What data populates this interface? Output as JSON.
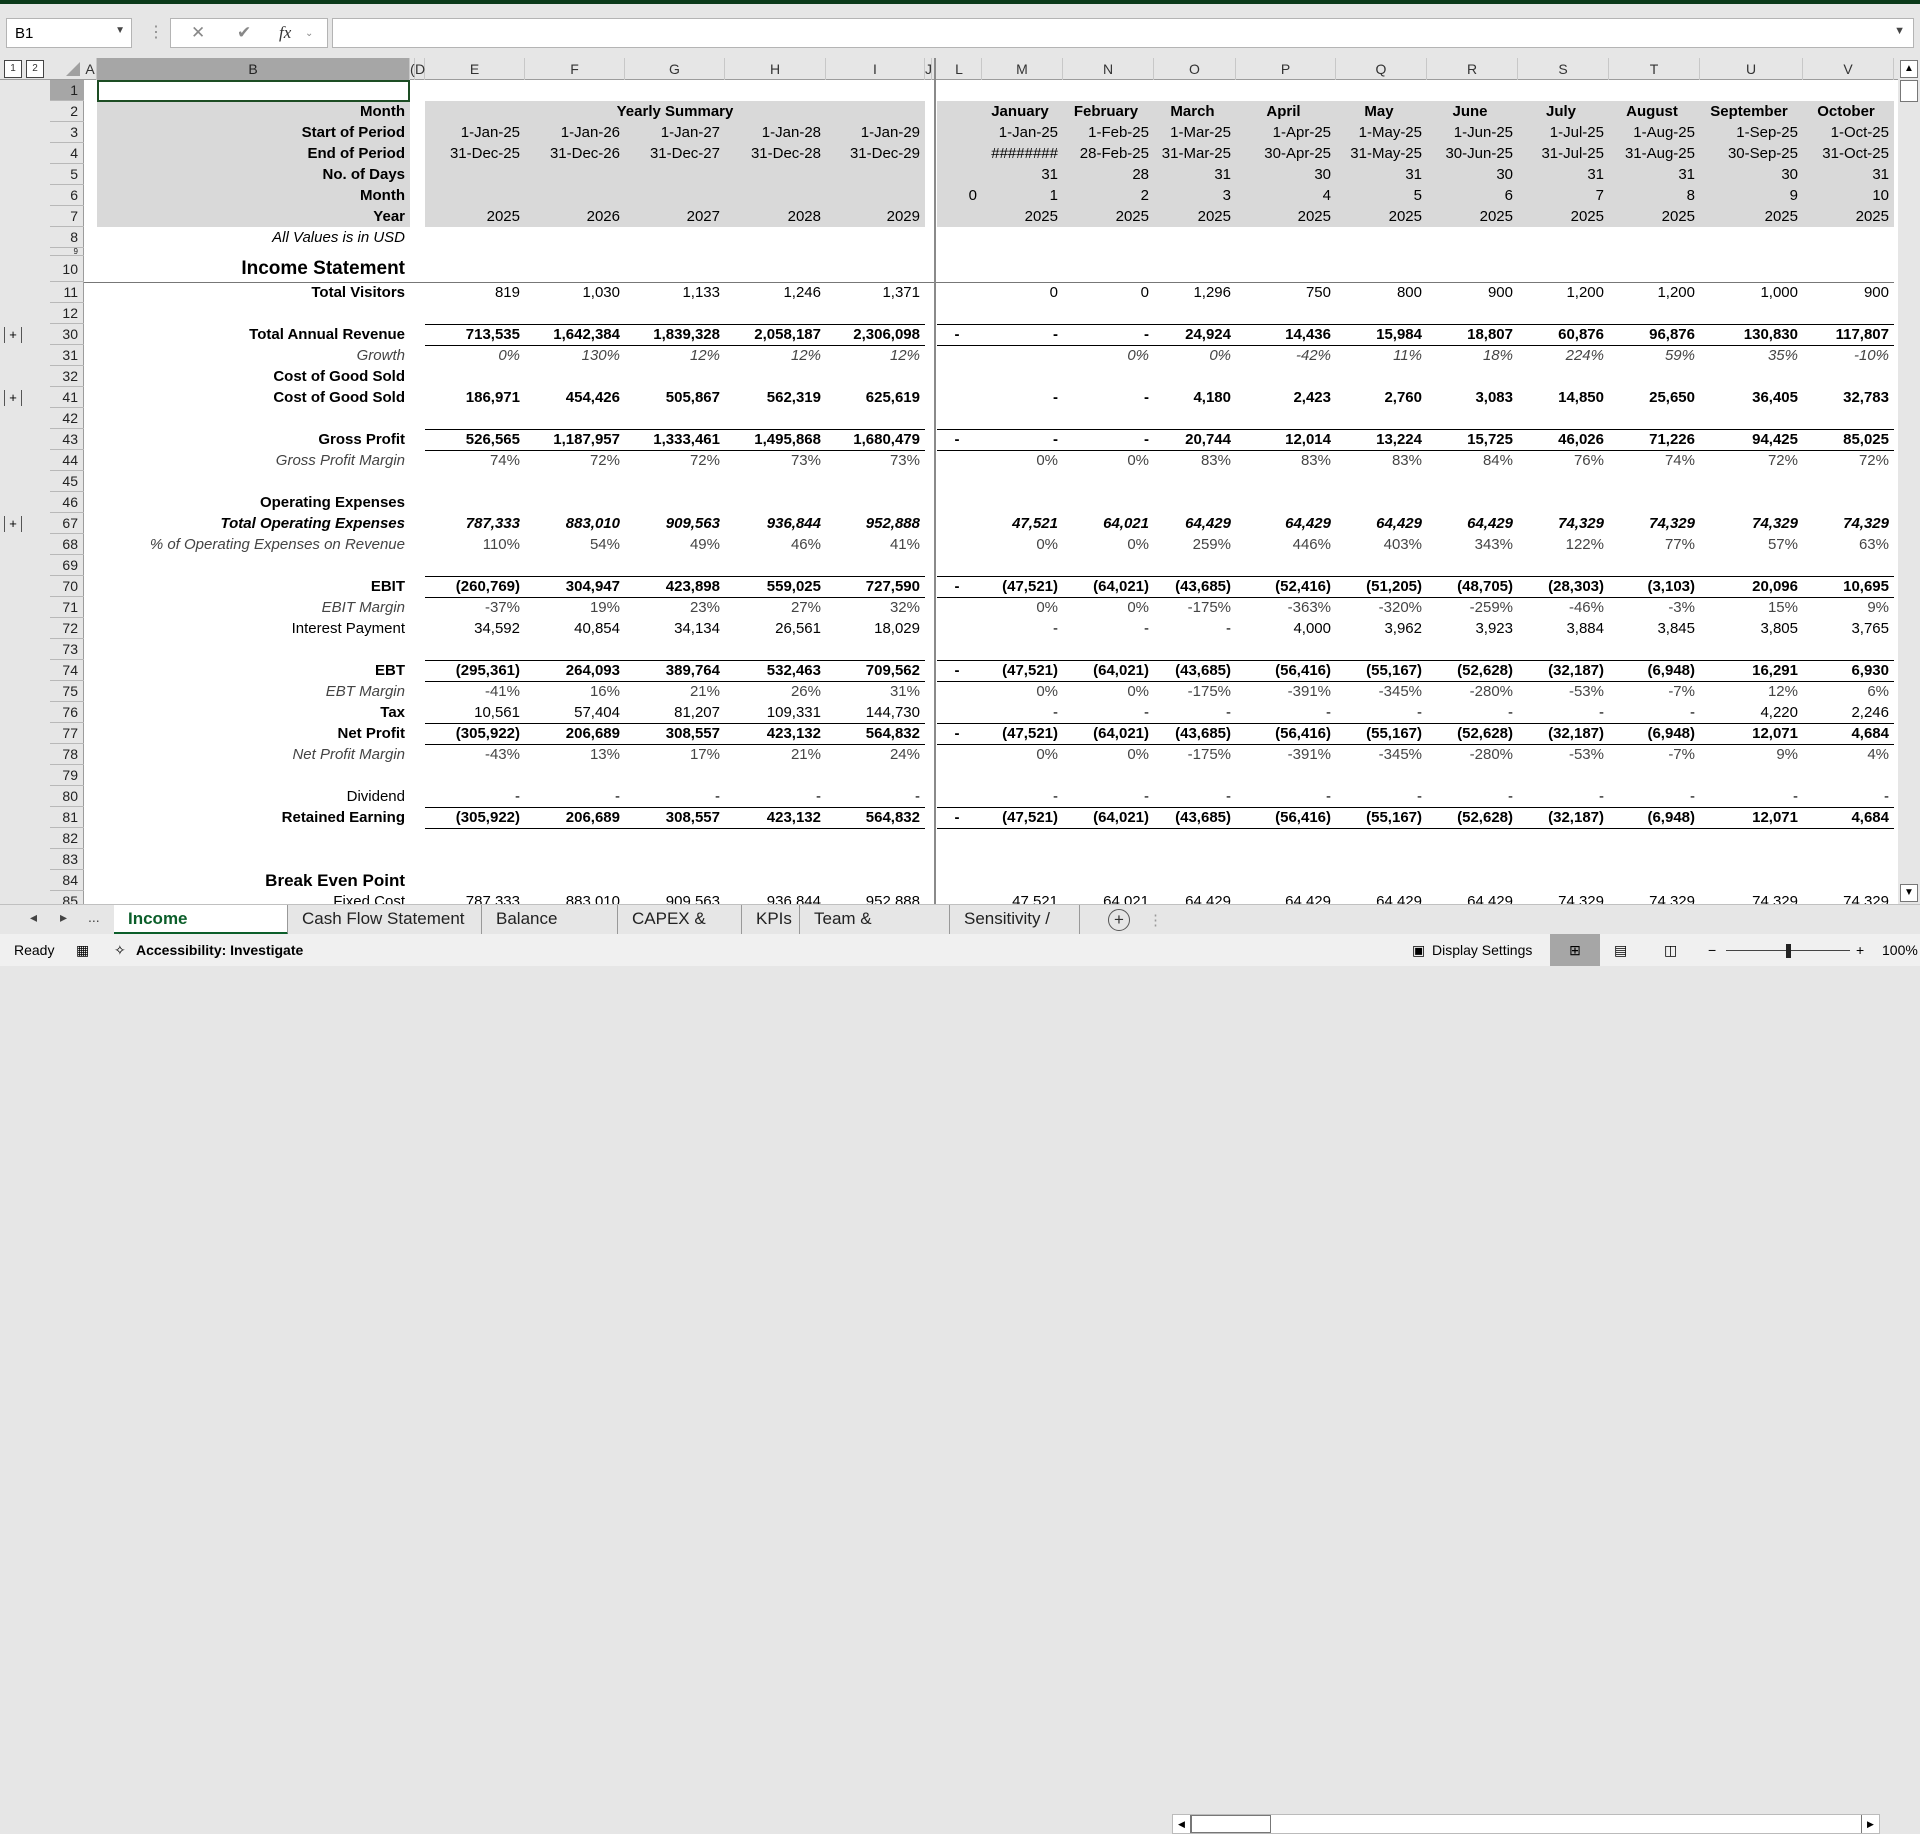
{
  "namebox": {
    "value": "B1"
  },
  "formula_bar": {
    "value": "",
    "fx_label": "fx"
  },
  "outline_levels": [
    "1",
    "2"
  ],
  "columns": [
    {
      "id": "A",
      "label": "A"
    },
    {
      "id": "B",
      "label": "B"
    },
    {
      "id": "C",
      "label": "("
    },
    {
      "id": "D",
      "label": "D"
    },
    {
      "id": "E",
      "label": "E"
    },
    {
      "id": "F",
      "label": "F"
    },
    {
      "id": "G",
      "label": "G"
    },
    {
      "id": "H",
      "label": "H"
    },
    {
      "id": "I",
      "label": "I"
    },
    {
      "id": "J",
      "label": "J"
    },
    {
      "id": "L",
      "label": "L"
    },
    {
      "id": "M",
      "label": "M"
    },
    {
      "id": "N",
      "label": "N"
    },
    {
      "id": "O",
      "label": "O"
    },
    {
      "id": "P",
      "label": "P"
    },
    {
      "id": "Q",
      "label": "Q"
    },
    {
      "id": "R",
      "label": "R"
    },
    {
      "id": "S",
      "label": "S"
    },
    {
      "id": "T",
      "label": "T"
    },
    {
      "id": "U",
      "label": "U"
    },
    {
      "id": "V",
      "label": "V"
    }
  ],
  "header_block": {
    "yearly_title": "Yearly Summary",
    "labels": [
      "Month",
      "Start of Period",
      "End of Period",
      "No. of Days",
      "Month",
      "Year"
    ],
    "note": "All Values is in USD",
    "yearly": {
      "start": [
        "1-Jan-25",
        "1-Jan-26",
        "1-Jan-27",
        "1-Jan-28",
        "1-Jan-29"
      ],
      "end": [
        "31-Dec-25",
        "31-Dec-26",
        "31-Dec-27",
        "31-Dec-28",
        "31-Dec-29"
      ],
      "year": [
        "2025",
        "2026",
        "2027",
        "2028",
        "2029"
      ]
    },
    "monthly": {
      "month_names": [
        "January",
        "February",
        "March",
        "April",
        "May",
        "June",
        "July",
        "August",
        "September",
        "October"
      ],
      "start": [
        "1-Jan-25",
        "1-Feb-25",
        "1-Mar-25",
        "1-Apr-25",
        "1-May-25",
        "1-Jun-25",
        "1-Jul-25",
        "1-Aug-25",
        "1-Sep-25",
        "1-Oct-25"
      ],
      "end": [
        "########",
        "28-Feb-25",
        "31-Mar-25",
        "30-Apr-25",
        "31-May-25",
        "30-Jun-25",
        "31-Jul-25",
        "31-Aug-25",
        "30-Sep-25",
        "31-Oct-25"
      ],
      "days": [
        "31",
        "28",
        "31",
        "30",
        "31",
        "30",
        "31",
        "31",
        "30",
        "31"
      ],
      "month_l": "0",
      "month_num": [
        "1",
        "2",
        "3",
        "4",
        "5",
        "6",
        "7",
        "8",
        "9",
        "10"
      ],
      "year": [
        "2025",
        "2025",
        "2025",
        "2025",
        "2025",
        "2025",
        "2025",
        "2025",
        "2025",
        "2025"
      ]
    }
  },
  "section_titles": {
    "income": "Income Statement",
    "breakeven": "Break Even Point"
  },
  "rows": [
    {
      "num": "11",
      "label": "Total Visitors",
      "style": "b",
      "yearly": [
        "819",
        "1,030",
        "1,133",
        "1,246",
        "1,371"
      ],
      "l": "",
      "monthly": [
        "0",
        "0",
        "1,296",
        "750",
        "800",
        "900",
        "1,200",
        "1,200",
        "1,000",
        "900"
      ],
      "vstyle": ""
    },
    {
      "num": "12",
      "label": "",
      "style": "",
      "yearly": [],
      "l": "",
      "monthly": []
    },
    {
      "num": "30",
      "label": "Total Annual Revenue",
      "style": "b",
      "group": true,
      "yearly": [
        "713,535",
        "1,642,384",
        "1,839,328",
        "2,058,187",
        "2,306,098"
      ],
      "l": "-",
      "monthly": [
        "-",
        "-",
        "24,924",
        "14,436",
        "15,984",
        "18,807",
        "60,876",
        "96,876",
        "130,830",
        "117,807"
      ],
      "vstyle": "b",
      "borders": true
    },
    {
      "num": "31",
      "label": "Growth",
      "style": "i g",
      "yearly": [
        "0%",
        "130%",
        "12%",
        "12%",
        "12%"
      ],
      "l": "",
      "monthly": [
        "",
        "0%",
        "0%",
        "-42%",
        "11%",
        "18%",
        "224%",
        "59%",
        "35%",
        "-10%"
      ],
      "vstyle": "i g"
    },
    {
      "num": "32",
      "label": "Cost of Good Sold",
      "style": "b",
      "yearly": [],
      "l": "",
      "monthly": []
    },
    {
      "num": "41",
      "label": "Cost of Good Sold",
      "style": "b",
      "group": true,
      "yearly": [
        "186,971",
        "454,426",
        "505,867",
        "562,319",
        "625,619"
      ],
      "l": "",
      "monthly": [
        "-",
        "-",
        "4,180",
        "2,423",
        "2,760",
        "3,083",
        "14,850",
        "25,650",
        "36,405",
        "32,783"
      ],
      "vstyle": "b"
    },
    {
      "num": "42",
      "label": "",
      "style": "",
      "yearly": [],
      "l": "",
      "monthly": []
    },
    {
      "num": "43",
      "label": "Gross Profit",
      "style": "b",
      "yearly": [
        "526,565",
        "1,187,957",
        "1,333,461",
        "1,495,868",
        "1,680,479"
      ],
      "l": "-",
      "monthly": [
        "-",
        "-",
        "20,744",
        "12,014",
        "13,224",
        "15,725",
        "46,026",
        "71,226",
        "94,425",
        "85,025"
      ],
      "vstyle": "b",
      "borders": true
    },
    {
      "num": "44",
      "label": "Gross Profit Margin",
      "style": "i g",
      "yearly": [
        "74%",
        "72%",
        "72%",
        "73%",
        "73%"
      ],
      "l": "",
      "monthly": [
        "0%",
        "0%",
        "83%",
        "83%",
        "83%",
        "84%",
        "76%",
        "74%",
        "72%",
        "72%"
      ],
      "vstyle": "g"
    },
    {
      "num": "45",
      "label": "",
      "style": "",
      "yearly": [],
      "l": "",
      "monthly": []
    },
    {
      "num": "46",
      "label": "Operating Expenses",
      "style": "b",
      "yearly": [],
      "l": "",
      "monthly": []
    },
    {
      "num": "67",
      "label": "Total Operating Expenses",
      "style": "b i",
      "group": true,
      "yearly": [
        "787,333",
        "883,010",
        "909,563",
        "936,844",
        "952,888"
      ],
      "l": "",
      "monthly": [
        "47,521",
        "64,021",
        "64,429",
        "64,429",
        "64,429",
        "64,429",
        "74,329",
        "74,329",
        "74,329",
        "74,329"
      ],
      "vstyle": "b i"
    },
    {
      "num": "68",
      "label": "% of Operating Expenses on Revenue",
      "style": "i g",
      "yearly": [
        "110%",
        "54%",
        "49%",
        "46%",
        "41%"
      ],
      "l": "",
      "monthly": [
        "0%",
        "0%",
        "259%",
        "446%",
        "403%",
        "343%",
        "122%",
        "77%",
        "57%",
        "63%"
      ],
      "vstyle": "g"
    },
    {
      "num": "69",
      "label": "",
      "style": "",
      "yearly": [],
      "l": "",
      "monthly": []
    },
    {
      "num": "70",
      "label": "EBIT",
      "style": "b",
      "yearly": [
        "(260,769)",
        "304,947",
        "423,898",
        "559,025",
        "727,590"
      ],
      "l": "-",
      "monthly": [
        "(47,521)",
        "(64,021)",
        "(43,685)",
        "(52,416)",
        "(51,205)",
        "(48,705)",
        "(28,303)",
        "(3,103)",
        "20,096",
        "10,695"
      ],
      "vstyle": "b",
      "borders": true
    },
    {
      "num": "71",
      "label": "EBIT Margin",
      "style": "i g",
      "yearly": [
        "-37%",
        "19%",
        "23%",
        "27%",
        "32%"
      ],
      "l": "",
      "monthly": [
        "0%",
        "0%",
        "-175%",
        "-363%",
        "-320%",
        "-259%",
        "-46%",
        "-3%",
        "15%",
        "9%"
      ],
      "vstyle": "g"
    },
    {
      "num": "72",
      "label": "Interest Payment",
      "style": "",
      "yearly": [
        "34,592",
        "40,854",
        "34,134",
        "26,561",
        "18,029"
      ],
      "l": "",
      "monthly": [
        "-",
        "-",
        "-",
        "4,000",
        "3,962",
        "3,923",
        "3,884",
        "3,845",
        "3,805",
        "3,765"
      ],
      "vstyle": ""
    },
    {
      "num": "73",
      "label": "",
      "style": "",
      "yearly": [],
      "l": "",
      "monthly": []
    },
    {
      "num": "74",
      "label": "EBT",
      "style": "b",
      "yearly": [
        "(295,361)",
        "264,093",
        "389,764",
        "532,463",
        "709,562"
      ],
      "l": "-",
      "monthly": [
        "(47,521)",
        "(64,021)",
        "(43,685)",
        "(56,416)",
        "(55,167)",
        "(52,628)",
        "(32,187)",
        "(6,948)",
        "16,291",
        "6,930"
      ],
      "vstyle": "b",
      "borders": true
    },
    {
      "num": "75",
      "label": "EBT Margin",
      "style": "i g",
      "yearly": [
        "-41%",
        "16%",
        "21%",
        "26%",
        "31%"
      ],
      "l": "",
      "monthly": [
        "0%",
        "0%",
        "-175%",
        "-391%",
        "-345%",
        "-280%",
        "-53%",
        "-7%",
        "12%",
        "6%"
      ],
      "vstyle": "g"
    },
    {
      "num": "76",
      "label": "Tax",
      "style": "b",
      "yearly": [
        "10,561",
        "57,404",
        "81,207",
        "109,331",
        "144,730"
      ],
      "l": "",
      "monthly": [
        "-",
        "-",
        "-",
        "-",
        "-",
        "-",
        "-",
        "-",
        "4,220",
        "2,246"
      ],
      "vstyle": ""
    },
    {
      "num": "77",
      "label": "Net Profit",
      "style": "b",
      "yearly": [
        "(305,922)",
        "206,689",
        "308,557",
        "423,132",
        "564,832"
      ],
      "l": "-",
      "monthly": [
        "(47,521)",
        "(64,021)",
        "(43,685)",
        "(56,416)",
        "(55,167)",
        "(52,628)",
        "(32,187)",
        "(6,948)",
        "12,071",
        "4,684"
      ],
      "vstyle": "b",
      "borders": true
    },
    {
      "num": "78",
      "label": "Net Profit Margin",
      "style": "i g",
      "yearly": [
        "-43%",
        "13%",
        "17%",
        "21%",
        "24%"
      ],
      "l": "",
      "monthly": [
        "0%",
        "0%",
        "-175%",
        "-391%",
        "-345%",
        "-280%",
        "-53%",
        "-7%",
        "9%",
        "4%"
      ],
      "vstyle": "g"
    },
    {
      "num": "79",
      "label": "",
      "style": "",
      "yearly": [],
      "l": "",
      "monthly": []
    },
    {
      "num": "80",
      "label": "Dividend",
      "style": "",
      "yearly": [
        "-",
        "-",
        "-",
        "-",
        "-"
      ],
      "l": "",
      "monthly": [
        "-",
        "-",
        "-",
        "-",
        "-",
        "-",
        "-",
        "-",
        "-",
        "-"
      ],
      "vstyle": ""
    },
    {
      "num": "81",
      "label": "Retained Earning",
      "style": "b",
      "yearly": [
        "(305,922)",
        "206,689",
        "308,557",
        "423,132",
        "564,832"
      ],
      "l": "-",
      "monthly": [
        "(47,521)",
        "(64,021)",
        "(43,685)",
        "(56,416)",
        "(55,167)",
        "(52,628)",
        "(32,187)",
        "(6,948)",
        "12,071",
        "4,684"
      ],
      "vstyle": "b",
      "borders": true
    },
    {
      "num": "82",
      "label": "",
      "style": "",
      "yearly": [],
      "l": "",
      "monthly": []
    },
    {
      "num": "83",
      "label": "",
      "style": "",
      "yearly": [],
      "l": "",
      "monthly": []
    },
    {
      "num": "84",
      "label": "Break Even Point",
      "style": "b title",
      "yearly": [],
      "l": "",
      "monthly": []
    },
    {
      "num": "85",
      "label": "Fixed Cost",
      "style": "",
      "yearly": [
        "787,333",
        "883,010",
        "909,563",
        "936,844",
        "952,888"
      ],
      "l": "",
      "monthly": [
        "47,521",
        "64,021",
        "64,429",
        "64,429",
        "64,429",
        "64,429",
        "74,329",
        "74,329",
        "74,329",
        "74,329"
      ],
      "vstyle": ""
    }
  ],
  "sheet_tabs": {
    "active": "Income Statement",
    "tabs": [
      "Income Statement",
      "Cash Flow Statement",
      "Balance Sheet",
      "CAPEX & OPEX",
      "KPIs",
      "Team & Salaries",
      "Sensitivity / ..."
    ],
    "more_label": "...",
    "add_label": "+"
  },
  "status_bar": {
    "ready": "Ready",
    "accessibility": "Accessibility: Investigate",
    "display_settings": "Display Settings",
    "zoom": "100%",
    "zoom_value": 100
  }
}
